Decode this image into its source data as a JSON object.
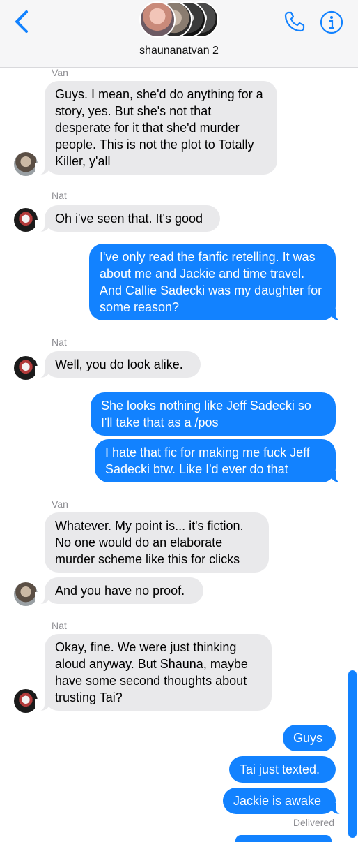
{
  "header": {
    "group_name": "shaunanatvan 2",
    "icons": [
      "back-chevron-icon",
      "phone-icon",
      "info-icon"
    ],
    "accent_color": "#1282ff"
  },
  "messages": [
    {
      "sender": "Van",
      "direction": "in",
      "text": "Guys. I mean, she'd do anything for a story, yes. But she's not that desperate for it that she'd murder people. This is not the plot to Totally Killer, y'all"
    },
    {
      "sender": "Nat",
      "direction": "in",
      "text": "Oh i've seen that. It's good"
    },
    {
      "direction": "out",
      "text": "I've only read the fanfic retelling. It was about me and Jackie and time travel. And Callie Sadecki was my daughter for some reason?"
    },
    {
      "sender": "Nat",
      "direction": "in",
      "text": "Well, you do look alike."
    },
    {
      "direction": "out",
      "text": "She looks nothing like Jeff Sadecki so I'll take that as a /pos"
    },
    {
      "direction": "out",
      "text": "I hate that fic for making me fuck Jeff Sadecki btw. Like I'd ever do that"
    },
    {
      "sender": "Van",
      "direction": "in",
      "text": "Whatever. My point is... it's fiction. No one would do an elaborate murder scheme like this for clicks"
    },
    {
      "direction": "in",
      "text": "And you have no proof."
    },
    {
      "sender": "Nat",
      "direction": "in",
      "text": "Okay, fine. We were just thinking aloud anyway. But Shauna, maybe have some second thoughts about trusting Tai?"
    },
    {
      "direction": "out",
      "text": "Guys"
    },
    {
      "direction": "out",
      "text": "Tai just texted."
    },
    {
      "direction": "out",
      "text": "Jackie is awake"
    }
  ],
  "status": {
    "delivered": "Delivered"
  }
}
